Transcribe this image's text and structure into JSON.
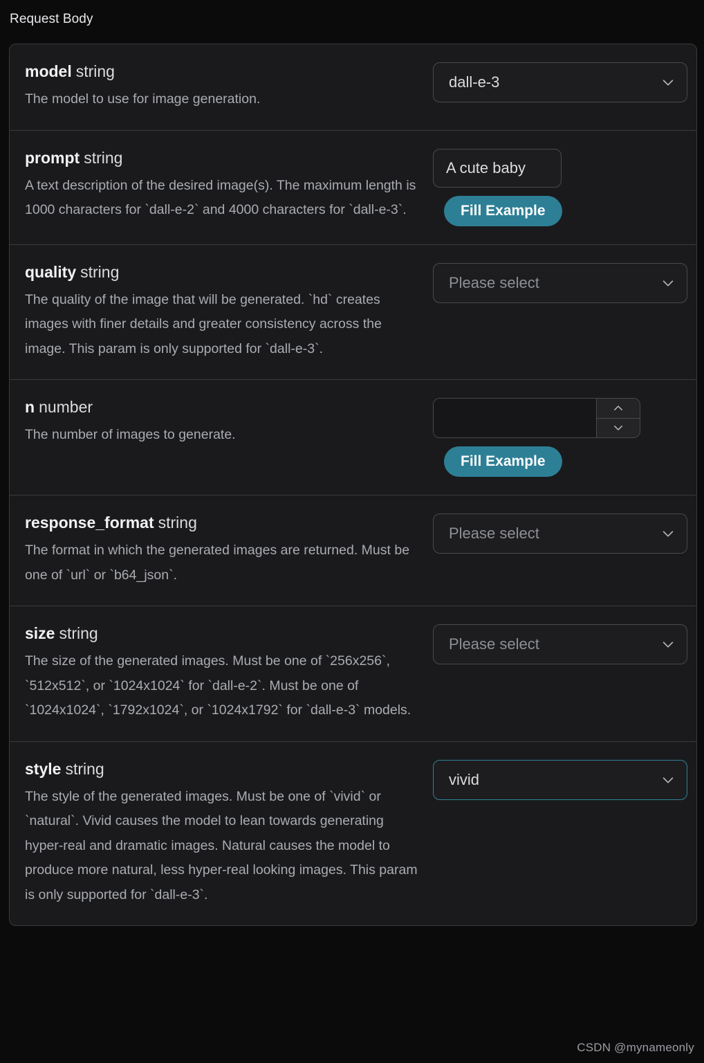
{
  "header": {
    "title": "Request Body"
  },
  "watermark": "CSDN @mynameonly",
  "colors": {
    "accent": "#2d7f96",
    "focus_border": "#2f8196",
    "card_bg": "#1a1a1c",
    "page_bg": "#0b0b0c",
    "border": "#3a3a3c",
    "text": "#e8e8ea",
    "muted_text": "#a9acb1"
  },
  "params": [
    {
      "name": "model",
      "type": "string",
      "description": "The model to use for image generation.",
      "control": "select",
      "value": "dall-e-3",
      "is_placeholder": false,
      "focused": false,
      "fill_example": null
    },
    {
      "name": "prompt",
      "type": "string",
      "description": "A text description of the desired image(s). The maximum length is 1000 characters for `dall-e-2` and 4000 characters for `dall-e-3`.",
      "control": "text",
      "value": "A cute baby",
      "is_placeholder": false,
      "focused": false,
      "fill_example": "Fill Example"
    },
    {
      "name": "quality",
      "type": "string",
      "description": "The quality of the image that will be generated. `hd` creates images with finer details and greater consistency across the image. This param is only supported for `dall-e-3`.",
      "control": "select",
      "value": "Please select",
      "is_placeholder": true,
      "focused": false,
      "fill_example": null
    },
    {
      "name": "n",
      "type": "number",
      "description": "The number of images to generate.",
      "control": "number",
      "value": "",
      "is_placeholder": false,
      "focused": false,
      "fill_example": "Fill Example"
    },
    {
      "name": "response_format",
      "type": "string",
      "description": "The format in which the generated images are returned. Must be one of `url` or `b64_json`.",
      "control": "select",
      "value": "Please select",
      "is_placeholder": true,
      "focused": false,
      "fill_example": null
    },
    {
      "name": "size",
      "type": "string",
      "description": "The size of the generated images. Must be one of `256x256`, `512x512`, or `1024x1024` for `dall-e-2`. Must be one of `1024x1024`, `1792x1024`, or `1024x1792` for `dall-e-3` models.",
      "control": "select",
      "value": "Please select",
      "is_placeholder": true,
      "focused": false,
      "fill_example": null
    },
    {
      "name": "style",
      "type": "string",
      "description": "The style of the generated images. Must be one of `vivid` or `natural`. Vivid causes the model to lean towards generating hyper-real and dramatic images. Natural causes the model to produce more natural, less hyper-real looking images. This param is only supported for `dall-e-3`.",
      "control": "select",
      "value": "vivid",
      "is_placeholder": false,
      "focused": true,
      "fill_example": null
    }
  ],
  "icons": {
    "chevron_down": "chevron-down-icon",
    "stepper_up": "chevron-up-icon",
    "stepper_down": "chevron-down-icon"
  }
}
